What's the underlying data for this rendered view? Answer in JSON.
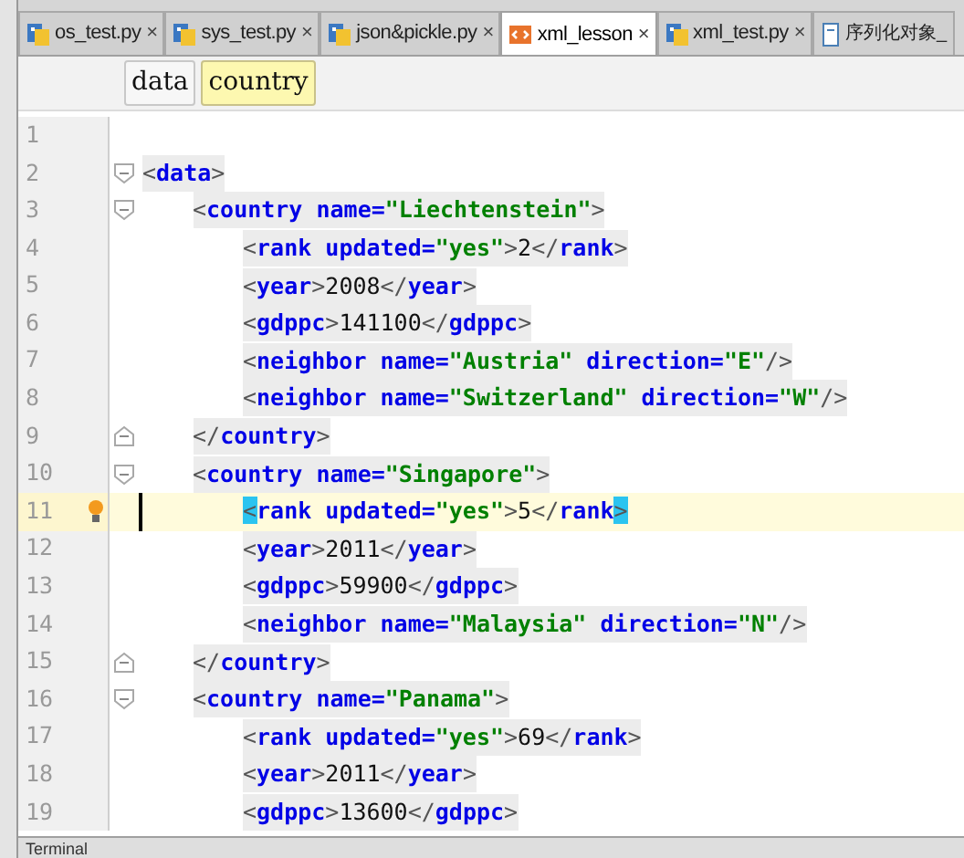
{
  "tabs": [
    {
      "label": "os_test.py",
      "kind": "python",
      "selected": false,
      "close": "×"
    },
    {
      "label": "sys_test.py",
      "kind": "python",
      "selected": false,
      "close": "×"
    },
    {
      "label": "json&pickle.py",
      "kind": "python",
      "selected": false,
      "close": "×"
    },
    {
      "label": "xml_lesson",
      "kind": "xml",
      "selected": true,
      "close": "×"
    },
    {
      "label": "xml_test.py",
      "kind": "python",
      "selected": false,
      "close": "×"
    },
    {
      "label": "序列化对象_",
      "kind": "file",
      "selected": false
    }
  ],
  "breadcrumbs": [
    {
      "label": "data",
      "selected": false
    },
    {
      "label": "country",
      "selected": true
    }
  ],
  "editor": {
    "lines": [
      {
        "number": "1"
      },
      {
        "number": "2",
        "kind": "fold_start",
        "tokens": [
          {
            "text": "<",
            "kind": "punct"
          },
          {
            "text": "data",
            "kind": "tag"
          },
          {
            "text": ">",
            "kind": "punct"
          }
        ],
        "children": [
          {
            "number": "3",
            "kind": "fold_start",
            "tokens": [
              {
                "text": "<",
                "kind": "punct"
              },
              {
                "text": "country",
                "kind": "tag"
              },
              {
                "text": " name=",
                "kind": "attr"
              },
              {
                "text": "\"Liechtenstein\"",
                "kind": "value"
              },
              {
                "text": ">",
                "kind": "punct"
              }
            ],
            "children": [
              {
                "number": "4",
                "tokens": [
                  {
                    "text": "<",
                    "kind": "punct"
                  },
                  {
                    "text": "rank",
                    "kind": "tag"
                  },
                  {
                    "text": " updated=",
                    "kind": "attr"
                  },
                  {
                    "text": "\"yes\"",
                    "kind": "value"
                  },
                  {
                    "text": ">",
                    "kind": "punct"
                  },
                  {
                    "text": "2",
                    "kind": "text"
                  },
                  {
                    "text": "</",
                    "kind": "punct"
                  },
                  {
                    "text": "rank",
                    "kind": "tag"
                  },
                  {
                    "text": ">",
                    "kind": "punct"
                  }
                ]
              },
              {
                "number": "5",
                "tokens": [
                  {
                    "text": "<",
                    "kind": "punct"
                  },
                  {
                    "text": "year",
                    "kind": "tag"
                  },
                  {
                    "text": ">",
                    "kind": "punct"
                  },
                  {
                    "text": "2008",
                    "kind": "text"
                  },
                  {
                    "text": "</",
                    "kind": "punct"
                  },
                  {
                    "text": "year",
                    "kind": "tag"
                  },
                  {
                    "text": ">",
                    "kind": "punct"
                  }
                ]
              },
              {
                "number": "6",
                "tokens": [
                  {
                    "text": "<",
                    "kind": "punct"
                  },
                  {
                    "text": "gdppc",
                    "kind": "tag"
                  },
                  {
                    "text": ">",
                    "kind": "punct"
                  },
                  {
                    "text": "141100",
                    "kind": "text"
                  },
                  {
                    "text": "</",
                    "kind": "punct"
                  },
                  {
                    "text": "gdppc",
                    "kind": "tag"
                  },
                  {
                    "text": ">",
                    "kind": "punct"
                  }
                ]
              },
              {
                "number": "7",
                "tokens": [
                  {
                    "text": "<",
                    "kind": "punct"
                  },
                  {
                    "text": "neighbor",
                    "kind": "tag"
                  },
                  {
                    "text": " name=",
                    "kind": "attr"
                  },
                  {
                    "text": "\"Austria\"",
                    "kind": "value"
                  },
                  {
                    "text": " direction=",
                    "kind": "attr"
                  },
                  {
                    "text": "\"E\"",
                    "kind": "value"
                  },
                  {
                    "text": "/>",
                    "kind": "punct"
                  }
                ]
              },
              {
                "number": "8",
                "tokens": [
                  {
                    "text": "<",
                    "kind": "punct"
                  },
                  {
                    "text": "neighbor",
                    "kind": "tag"
                  },
                  {
                    "text": " name=",
                    "kind": "attr"
                  },
                  {
                    "text": "\"Switzerland\"",
                    "kind": "value"
                  },
                  {
                    "text": " direction=",
                    "kind": "attr"
                  },
                  {
                    "text": "\"W\"",
                    "kind": "value"
                  },
                  {
                    "text": "/>",
                    "kind": "punct"
                  }
                ]
              }
            ]
          },
          {
            "number": "9",
            "kind": "fold_end",
            "tokens": [
              {
                "text": "</",
                "kind": "punct"
              },
              {
                "text": "country",
                "kind": "tag"
              },
              {
                "text": ">",
                "kind": "punct"
              }
            ]
          },
          {
            "number": "10",
            "kind": "fold_start",
            "tokens": [
              {
                "text": "<",
                "kind": "punct"
              },
              {
                "text": "country",
                "kind": "tag"
              },
              {
                "text": " name=",
                "kind": "attr"
              },
              {
                "text": "\"Singapore\"",
                "kind": "value"
              },
              {
                "text": ">",
                "kind": "punct"
              }
            ],
            "children": [
              {
                "number": "11",
                "current": true,
                "tokens": [
                  {
                    "text": "<",
                    "kind": "punct",
                    "matched": true
                  },
                  {
                    "text": "rank",
                    "kind": "tag"
                  },
                  {
                    "text": " updated=",
                    "kind": "attr"
                  },
                  {
                    "text": "\"yes\"",
                    "kind": "value"
                  },
                  {
                    "text": ">",
                    "kind": "punct"
                  },
                  {
                    "text": "5",
                    "kind": "text"
                  },
                  {
                    "text": "</",
                    "kind": "punct"
                  },
                  {
                    "text": "rank",
                    "kind": "tag"
                  },
                  {
                    "text": ">",
                    "kind": "punct",
                    "matched": true
                  }
                ]
              },
              {
                "number": "12",
                "tokens": [
                  {
                    "text": "<",
                    "kind": "punct"
                  },
                  {
                    "text": "year",
                    "kind": "tag"
                  },
                  {
                    "text": ">",
                    "kind": "punct"
                  },
                  {
                    "text": "2011",
                    "kind": "text"
                  },
                  {
                    "text": "</",
                    "kind": "punct"
                  },
                  {
                    "text": "year",
                    "kind": "tag"
                  },
                  {
                    "text": ">",
                    "kind": "punct"
                  }
                ]
              },
              {
                "number": "13",
                "tokens": [
                  {
                    "text": "<",
                    "kind": "punct"
                  },
                  {
                    "text": "gdppc",
                    "kind": "tag"
                  },
                  {
                    "text": ">",
                    "kind": "punct"
                  },
                  {
                    "text": "59900",
                    "kind": "text"
                  },
                  {
                    "text": "</",
                    "kind": "punct"
                  },
                  {
                    "text": "gdppc",
                    "kind": "tag"
                  },
                  {
                    "text": ">",
                    "kind": "punct"
                  }
                ]
              },
              {
                "number": "14",
                "tokens": [
                  {
                    "text": "<",
                    "kind": "punct"
                  },
                  {
                    "text": "neighbor",
                    "kind": "tag"
                  },
                  {
                    "text": " name=",
                    "kind": "attr"
                  },
                  {
                    "text": "\"Malaysia\"",
                    "kind": "value"
                  },
                  {
                    "text": " direction=",
                    "kind": "attr"
                  },
                  {
                    "text": "\"N\"",
                    "kind": "value"
                  },
                  {
                    "text": "/>",
                    "kind": "punct"
                  }
                ]
              }
            ]
          },
          {
            "number": "15",
            "kind": "fold_end",
            "tokens": [
              {
                "text": "</",
                "kind": "punct"
              },
              {
                "text": "country",
                "kind": "tag"
              },
              {
                "text": ">",
                "kind": "punct"
              }
            ]
          },
          {
            "number": "16",
            "kind": "fold_start",
            "tokens": [
              {
                "text": "<",
                "kind": "punct"
              },
              {
                "text": "country",
                "kind": "tag"
              },
              {
                "text": " name=",
                "kind": "attr"
              },
              {
                "text": "\"Panama\"",
                "kind": "value"
              },
              {
                "text": ">",
                "kind": "punct"
              }
            ],
            "children": [
              {
                "number": "17",
                "tokens": [
                  {
                    "text": "<",
                    "kind": "punct"
                  },
                  {
                    "text": "rank",
                    "kind": "tag"
                  },
                  {
                    "text": " updated=",
                    "kind": "attr"
                  },
                  {
                    "text": "\"yes\"",
                    "kind": "value"
                  },
                  {
                    "text": ">",
                    "kind": "punct"
                  },
                  {
                    "text": "69",
                    "kind": "text"
                  },
                  {
                    "text": "</",
                    "kind": "punct"
                  },
                  {
                    "text": "rank",
                    "kind": "tag"
                  },
                  {
                    "text": ">",
                    "kind": "punct"
                  }
                ]
              },
              {
                "number": "18",
                "tokens": [
                  {
                    "text": "<",
                    "kind": "punct"
                  },
                  {
                    "text": "year",
                    "kind": "tag"
                  },
                  {
                    "text": ">",
                    "kind": "punct"
                  },
                  {
                    "text": "2011",
                    "kind": "text"
                  },
                  {
                    "text": "</",
                    "kind": "punct"
                  },
                  {
                    "text": "year",
                    "kind": "tag"
                  },
                  {
                    "text": ">",
                    "kind": "punct"
                  }
                ]
              },
              {
                "number": "19",
                "tokens": [
                  {
                    "text": "<",
                    "kind": "punct"
                  },
                  {
                    "text": "gdppc",
                    "kind": "tag"
                  },
                  {
                    "text": ">",
                    "kind": "punct"
                  },
                  {
                    "text": "13600",
                    "kind": "text"
                  },
                  {
                    "text": "</",
                    "kind": "punct"
                  },
                  {
                    "text": "gdppc",
                    "kind": "tag"
                  },
                  {
                    "text": ">",
                    "kind": "punct"
                  }
                ]
              }
            ]
          }
        ]
      }
    ]
  },
  "bottom_bar": {
    "label": "Terminal"
  }
}
